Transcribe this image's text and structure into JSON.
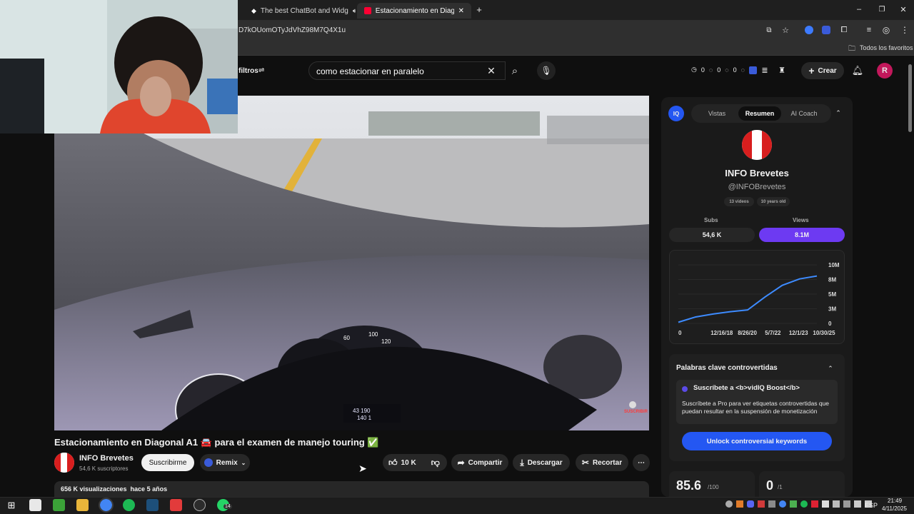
{
  "browser": {
    "tabs": [
      {
        "title": "The best ChatBot and Widg",
        "active": false
      },
      {
        "title": "Estacionamiento en Diagonal A",
        "active": true
      }
    ],
    "url_fragment": "D7kOUomOTyJdVhZ98M7Q4X1u",
    "bookmarks_label": "Todos los favoritos"
  },
  "youtube": {
    "filters_label": "filtros",
    "search_value": "como estacionar en paralelo",
    "create_label": "Crear",
    "avatar_letter": "R",
    "counters": [
      "0",
      "0",
      "0",
      "0"
    ]
  },
  "video": {
    "subscribe_watermark": "SUSCRIBIR",
    "speedo": [
      "60",
      "100",
      "120"
    ],
    "odometer": [
      "43 190",
      "140 1"
    ],
    "title": "Estacionamiento en Diagonal A1 🚘 para el examen de manejo touring ✅",
    "channel_name": "INFO Brevetes",
    "channel_subs": "54,6 K suscriptores",
    "subscribe_label": "Suscribirme",
    "remix_label": "Remix",
    "likes": "10 K",
    "share_label": "Compartir",
    "download_label": "Descargar",
    "clip_label": "Recortar",
    "views_line": "656 K visualizaciones  hace 5 años"
  },
  "vidiq": {
    "tabs": [
      "Vistas",
      "Resumen",
      "AI Coach"
    ],
    "active_tab": "Resumen",
    "channel_name": "INFO Brevetes",
    "handle": "@INFOBrevetes",
    "video_count": "13 videos",
    "age": "10 years old",
    "subs_label": "Subs",
    "subs_value": "54,6 K",
    "views_label": "Views",
    "views_value": "8.1M",
    "chart_data": {
      "type": "line",
      "x_ticks": [
        "0",
        "12/16/18",
        "8/26/20",
        "5/7/22",
        "12/1/23",
        "10/30/25"
      ],
      "y_ticks": [
        "10M",
        "8M",
        "5M",
        "3M",
        "0"
      ],
      "series": [
        {
          "values": [
            0.2,
            1.1,
            1.6,
            2.0,
            2.3,
            4.5,
            6.5,
            7.6,
            8.1
          ]
        }
      ],
      "xlabel": "",
      "ylabel": ""
    },
    "keywords_title": "Palabras clave controvertidas",
    "boost_title": "Suscríbete a <b>vidIQ Boost</b>",
    "boost_text": "Suscríbete a Pro para ver etiquetas controvertidas que puedan resultar en la suspensión de monetización",
    "unlock_label": "Unlock controversial keywords",
    "score_value": "85.6",
    "score_unit": "/100",
    "score2_value": "0",
    "score2_unit": "/1"
  },
  "taskbar": {
    "lang": "ESP",
    "time": "21:49",
    "date": "4/11/2025",
    "badge": "14"
  },
  "colors": {
    "accent_purple": "#6d3af2",
    "unlock_blue": "#2457f2",
    "yt_red": "#ff0033"
  }
}
